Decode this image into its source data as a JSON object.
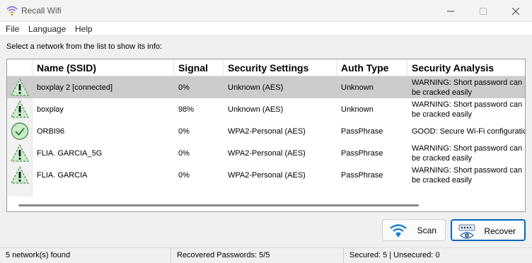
{
  "window": {
    "title": "Recall Wifi"
  },
  "menu": {
    "items": [
      "File",
      "Language",
      "Help"
    ]
  },
  "instruction": "Select a network from the list to show its info:",
  "table": {
    "columns": [
      "Name (SSID)",
      "Signal",
      "Security Settings",
      "Auth Type",
      "Security Analysis"
    ],
    "rows": [
      {
        "status_icon": "warning-triangle-icon",
        "name": "boxplay 2 [connected]",
        "signal": "0%",
        "security": "Unknown (AES)",
        "auth": "Unknown",
        "analysis": "WARNING: Short password can be cracked easily",
        "selected": true
      },
      {
        "status_icon": "warning-triangle-icon",
        "name": "boxplay",
        "signal": "98%",
        "security": "Unknown (AES)",
        "auth": "Unknown",
        "analysis": "WARNING: Short password can be cracked easily",
        "selected": false
      },
      {
        "status_icon": "check-circle-icon",
        "name": "ORBI96",
        "signal": "0%",
        "security": "WPA2-Personal (AES)",
        "auth": "PassPhrase",
        "analysis": "GOOD: Secure Wi-Fi configuration",
        "selected": false
      },
      {
        "status_icon": "warning-triangle-icon",
        "name": "FLIA. GARCIA_5G",
        "signal": "0%",
        "security": "WPA2-Personal (AES)",
        "auth": "PassPhrase",
        "analysis": "WARNING: Short password can be cracked easily",
        "selected": false
      },
      {
        "status_icon": "warning-triangle-icon",
        "name": "FLIA. GARCIA",
        "signal": "0%",
        "security": "WPA2-Personal (AES)",
        "auth": "PassPhrase",
        "analysis": "WARNING: Short password can be cracked easily",
        "selected": false
      }
    ]
  },
  "buttons": {
    "scan": "Scan",
    "recover": "Recover"
  },
  "status": {
    "found": "5 network(s) found",
    "recovered": "Recovered Passwords: 5/5",
    "secured": "Secured: 5 | Unsecured: 0"
  },
  "colors": {
    "accent": "#0067c0",
    "warning_fill": "#c9ecc9",
    "good_fill": "#c9ecc9",
    "selected_row": "#cccccc"
  }
}
